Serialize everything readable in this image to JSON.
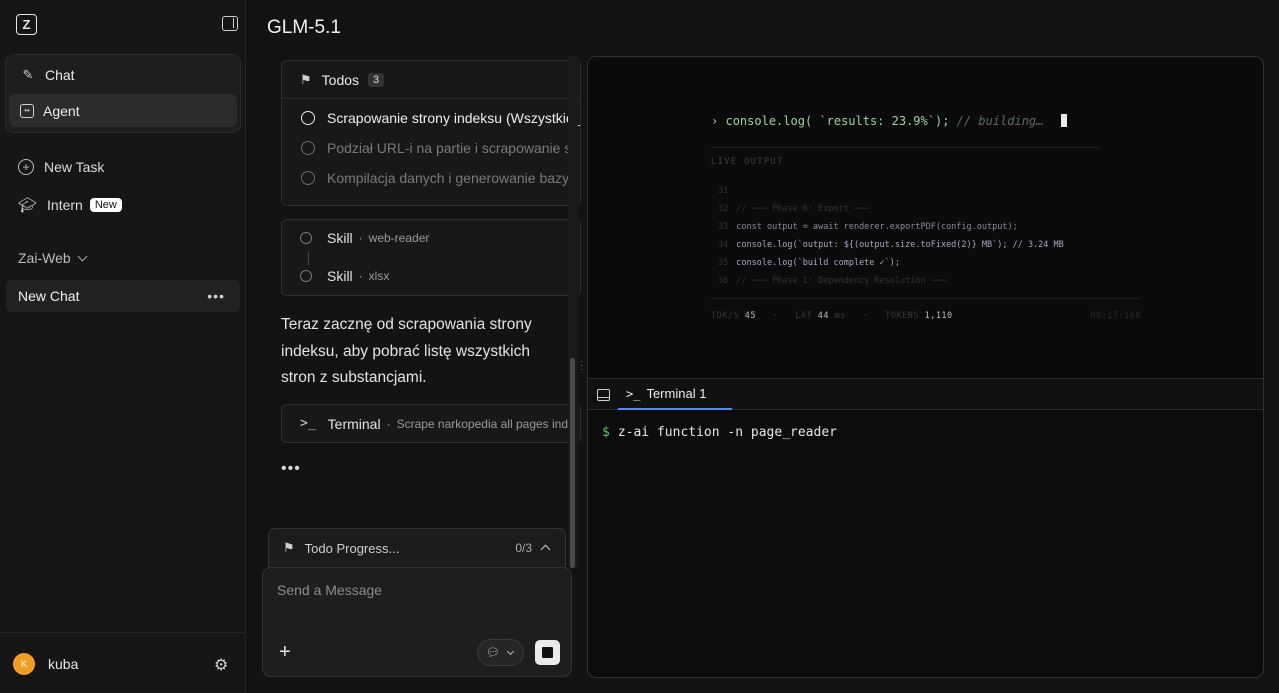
{
  "sidebar": {
    "logo": "Z",
    "modes": [
      {
        "label": "Chat",
        "icon": "edit-icon"
      },
      {
        "label": "Agent",
        "icon": "robot-icon"
      }
    ],
    "new_task": "New Task",
    "intern": "Intern",
    "intern_badge": "New",
    "section": "Zai-Web",
    "chats": [
      {
        "label": "New Chat"
      }
    ],
    "user": {
      "initial": "K",
      "name": "kuba"
    }
  },
  "header": {
    "title": "GLM-5.1"
  },
  "chat": {
    "todos": {
      "title": "Todos",
      "count": "3",
      "items": [
        {
          "label": "Scrapowanie strony indeksu (Wszystkie_",
          "state": "active"
        },
        {
          "label": "Podział URL-i na partie i scrapowanie sz",
          "state": "pending"
        },
        {
          "label": "Kompilacja danych i generowanie bazy",
          "state": "pending"
        }
      ]
    },
    "skills": [
      {
        "label": "Skill",
        "sub": "web-reader"
      },
      {
        "label": "Skill",
        "sub": "xlsx"
      }
    ],
    "message": "Teraz zacznę od scrapowania strony indeksu, aby pobrać listę wszystkich stron z substancjami.",
    "terminal_call": {
      "label": "Terminal",
      "sub": "Scrape narkopedia all pages ind"
    },
    "typing": "•••",
    "progress": {
      "label": "Todo Progress...",
      "fraction": "0/3"
    },
    "composer": {
      "placeholder": "Send a Message"
    }
  },
  "preview": {
    "main_line": {
      "prompt": "›",
      "code": "console.log( `results: 23.9%`);",
      "comment": "// building…"
    },
    "live_label": "LIVE OUTPUT",
    "lines": [
      {
        "n": "31",
        "text": ""
      },
      {
        "n": "32",
        "text": "// ─── Phase 6: Export ───"
      },
      {
        "n": "33",
        "text": "const output = await renderer.exportPDF(config.output);"
      },
      {
        "n": "34",
        "text": "console.log(`output: ${(output.size.toFixed(2)} MB`); // 3.24 MB"
      },
      {
        "n": "35",
        "text": "console.log(`build complete ✓`);"
      },
      {
        "n": "36",
        "text": "// ─── Phase 1: Dependency Resolution ───"
      }
    ],
    "stats": {
      "tok_label": "TOK/S",
      "tok": "45",
      "lat_label": "LAT",
      "lat": "44",
      "lat_unit": "ms",
      "tokens_label": "TOKENS",
      "tokens": "1,110",
      "time": "08:17:168"
    }
  },
  "terminal": {
    "tab": "Terminal 1",
    "prompt": "$",
    "command": "z-ai function -n page_reader"
  }
}
